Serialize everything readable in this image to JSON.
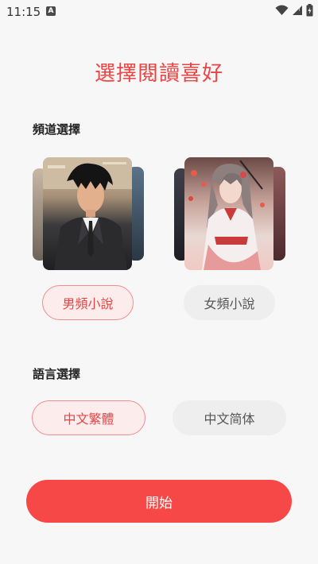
{
  "status_bar": {
    "time": "11:15",
    "notification_icon": "A",
    "icons": [
      "wifi-icon",
      "signal-icon",
      "battery-charging-icon"
    ]
  },
  "title": "選擇閱讀喜好",
  "channel_section": {
    "label": "頻道選擇",
    "options": [
      {
        "label": "男頻小說",
        "selected": true,
        "cover": "male-cover"
      },
      {
        "label": "女頻小說",
        "selected": false,
        "cover": "female-cover"
      }
    ]
  },
  "language_section": {
    "label": "語言選擇",
    "options": [
      {
        "label": "中文繁體",
        "selected": true
      },
      {
        "label": "中文简体",
        "selected": false
      }
    ]
  },
  "start_button": {
    "label": "開始"
  },
  "colors": {
    "accent": "#ee4343",
    "button": "#f74848",
    "selected_bg": "#fdecec",
    "selected_border": "#f08c8c",
    "unselected_bg": "#eeeeee"
  }
}
